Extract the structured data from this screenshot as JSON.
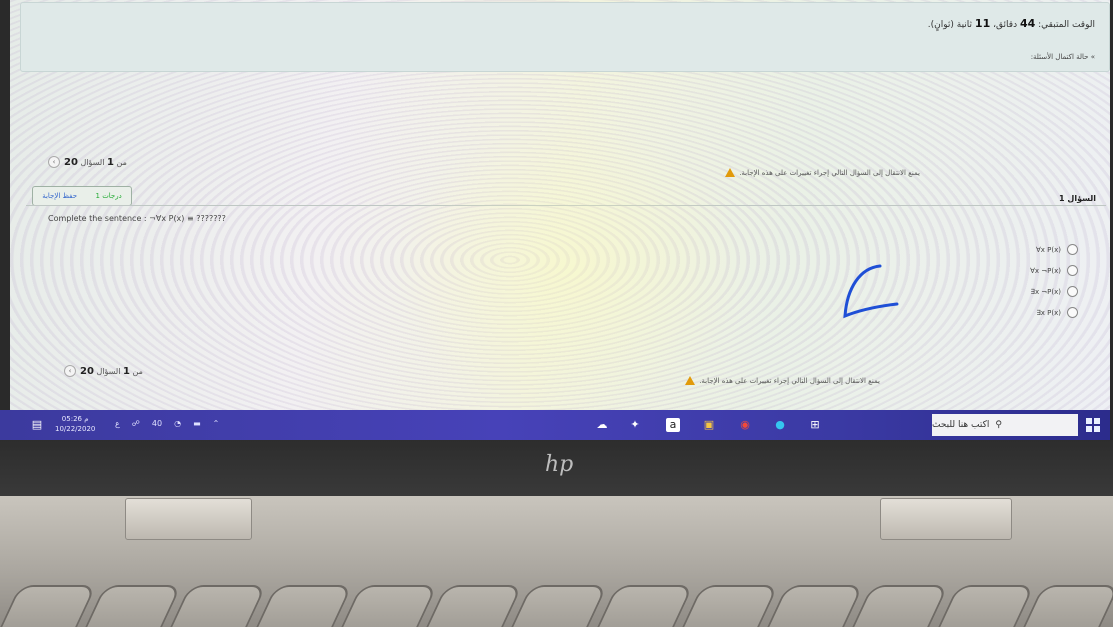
{
  "timer": {
    "label": "الوقت المتبقي:",
    "minutes": "44",
    "minutes_unit": "دقائق،",
    "seconds": "11",
    "seconds_unit": "ثانية (ثوانٍ)."
  },
  "status_link": "» حالة اكتمال الأسئلة:",
  "navigation": {
    "question_word": "السؤال",
    "current": "1",
    "of_word": "من",
    "total": "20"
  },
  "warning": "يمنع الانتقال إلى السؤال التالي إجراء تغييرات على هذه الإجابة.",
  "points_box": {
    "points": "1 درجات",
    "save": "حفظ الإجابة"
  },
  "question": {
    "label": "السؤال 1",
    "text": "Complete the sentence : ¬∀x P(x) ≡ ???????",
    "options": [
      "∀x P(x)",
      "∀x ¬P(x)",
      "∃x ¬P(x)",
      "∃x P(x)"
    ]
  },
  "taskbar": {
    "search_placeholder": "اكتب هنا للبحث",
    "time": "05:26 م",
    "date": "10/22/2020",
    "tray_lang": "ع",
    "tray_volume": "40"
  },
  "hardware": {
    "brand": "hp"
  },
  "colors": {
    "accent": "#4742b8",
    "warning": "#e19a0a",
    "panel": "#dfe9e8",
    "ink": "#1f4fd6"
  }
}
